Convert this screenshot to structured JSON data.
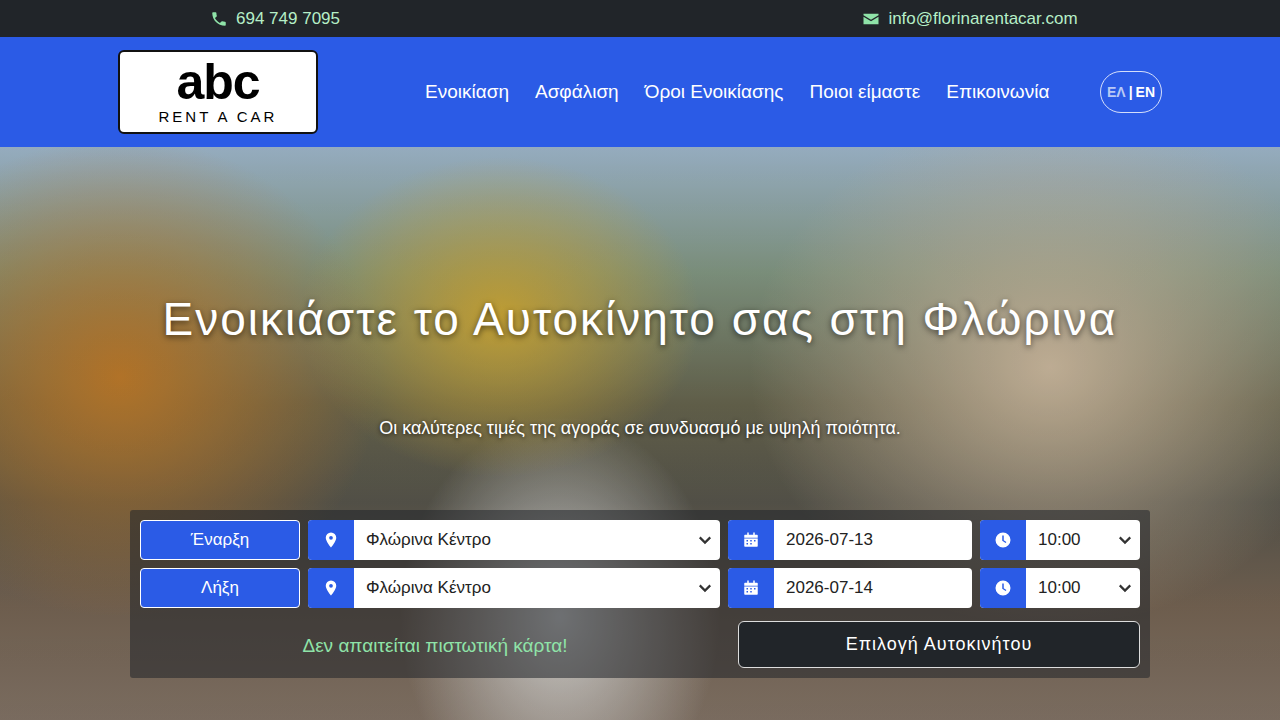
{
  "topbar": {
    "phone": "694 749 7095",
    "email": "info@florinarentacar.com"
  },
  "logo": {
    "mark": "abc",
    "tagline": "RENT A CAR"
  },
  "nav": [
    "Ενοικίαση",
    "Ασφάλιση",
    "Όροι Ενοικίασης",
    "Ποιοι είμαστε",
    "Επικοινωνία"
  ],
  "language": {
    "separator": "|",
    "options": [
      {
        "label": "ΕΛ",
        "selected": true
      },
      {
        "label": "EN",
        "selected": false
      }
    ]
  },
  "hero": {
    "title": "Ενοικιάστε το Αυτοκίνητο σας στη Φλώρινα",
    "subtitle": "Οι καλύτερες τιμές της αγοράς σε συνδυασμό με υψηλή ποιότητα."
  },
  "form": {
    "rows": [
      {
        "label": "Έναρξη",
        "location": "Φλώρινα Κέντρο",
        "date": "2026-07-13",
        "time": "10:00"
      },
      {
        "label": "Λήξη",
        "location": "Φλώρινα Κέντρο",
        "date": "2026-07-14",
        "time": "10:00"
      }
    ],
    "note": "Δεν απαιτείται πιστωτική κάρτα!",
    "submit": "Επιλογή Αυτοκινήτου"
  }
}
